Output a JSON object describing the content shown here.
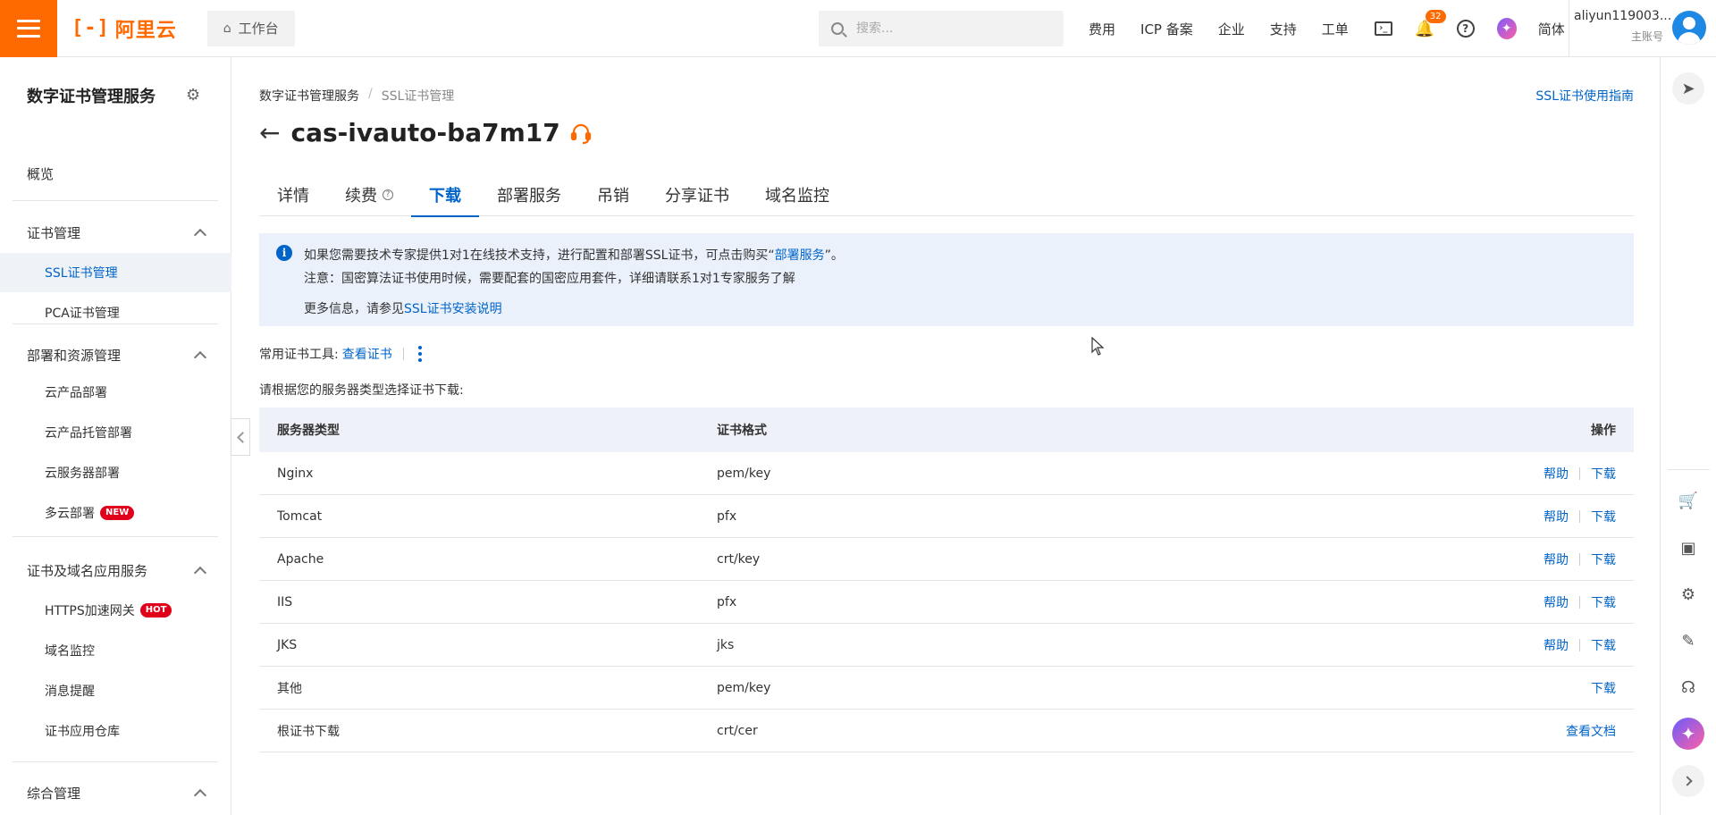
{
  "topbar": {
    "logo_mark": "[-]",
    "logo_text": "阿里云",
    "workbench_label": "工作台",
    "search_placeholder": "搜索...",
    "nav_items": [
      "费用",
      "ICP 备案",
      "企业",
      "支持",
      "工单"
    ],
    "notification_count": "32",
    "language_label": "简体",
    "account_name": "aliyun119003...",
    "account_role": "主账号"
  },
  "sidebar": {
    "title": "数字证书管理服务",
    "overview": "概览",
    "groups": [
      {
        "label": "证书管理",
        "items": [
          "SSL证书管理",
          "PCA证书管理"
        ]
      },
      {
        "label": "部署和资源管理",
        "items": [
          "云产品部署",
          "云产品托管部署",
          "云服务器部署",
          "多云部署"
        ]
      },
      {
        "label": "证书及域名应用服务",
        "items": [
          "HTTPS加速网关",
          "域名监控",
          "消息提醒",
          "证书应用仓库"
        ]
      },
      {
        "label": "综合管理",
        "items": []
      }
    ],
    "tag_new": "NEW",
    "tag_hot": "HOT"
  },
  "breadcrumb": {
    "root": "数字证书管理服务",
    "current": "SSL证书管理"
  },
  "guide_link": "SSL证书使用指南",
  "page_title": "cas-ivauto-ba7m17",
  "tabs": [
    "详情",
    "续费",
    "下载",
    "部署服务",
    "吊销",
    "分享证书",
    "域名监控"
  ],
  "active_tab": "下载",
  "notice": {
    "line1_prefix": "如果您需要技术专家提供1对1在线技术支持，进行配置和部署SSL证书，可点击购买“",
    "line1_link": "部署服务",
    "line1_suffix": "”。",
    "line2": "注意：国密算法证书使用时候，需要配套的国密应用套件，详细请联系1对1专家服务了解",
    "line3_prefix": "更多信息，请参见",
    "line3_link": "SSL证书安装说明"
  },
  "tools": {
    "label": "常用证书工具:",
    "link": "查看证书"
  },
  "instruction": "请根据您的服务器类型选择证书下载:",
  "table": {
    "headers": {
      "server": "服务器类型",
      "format": "证书格式",
      "action": "操作"
    },
    "help_label": "帮助",
    "download_label": "下载",
    "doc_label": "查看文档",
    "rows": [
      {
        "server": "Nginx",
        "format": "pem/key"
      },
      {
        "server": "Tomcat",
        "format": "pfx"
      },
      {
        "server": "Apache",
        "format": "crt/key"
      },
      {
        "server": "IIS",
        "format": "pfx"
      },
      {
        "server": "JKS",
        "format": "jks"
      },
      {
        "server": "其他",
        "format": "pem/key"
      },
      {
        "server": "根证书下载",
        "format": "crt/cer"
      }
    ]
  },
  "colors": {
    "brand": "#ff6a00",
    "link": "#0064c8",
    "notice_bg": "#eaf1fb",
    "header_bg": "#eef2f8"
  }
}
